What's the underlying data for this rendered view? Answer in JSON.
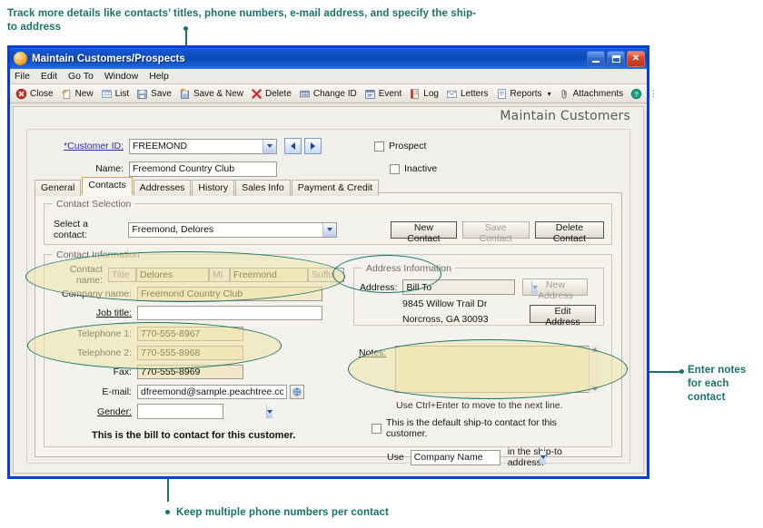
{
  "annotations": {
    "top": "Track more details like contacts’ titles, phone numbers, e-mail address, and specify the ship-to address",
    "right": "Enter notes for each contact",
    "bottom": "Keep multiple phone numbers per contact",
    "accent_color": "#18736b",
    "highlight_fill": "#eee4aa"
  },
  "window": {
    "title": "Maintain Customers/Prospects",
    "controls": {
      "minimize": "Minimize",
      "maximize": "Maximize",
      "close": "Close"
    }
  },
  "menubar": {
    "items": [
      "File",
      "Edit",
      "Go To",
      "Window",
      "Help"
    ]
  },
  "toolbar": {
    "items": [
      {
        "label": "Close",
        "icon": "close-circle-icon"
      },
      {
        "label": "New",
        "icon": "new-page-icon"
      },
      {
        "label": "List",
        "icon": "list-grid-icon"
      },
      {
        "label": "Save",
        "icon": "save-disk-icon"
      },
      {
        "label": "Save & New",
        "icon": "save-new-icon"
      },
      {
        "label": "Delete",
        "icon": "delete-x-icon"
      },
      {
        "label": "Change ID",
        "icon": "change-id-icon"
      },
      {
        "label": "Event",
        "icon": "event-icon"
      },
      {
        "label": "Log",
        "icon": "log-book-icon"
      },
      {
        "label": "Letters",
        "icon": "letters-envelope-icon"
      },
      {
        "label": "Reports",
        "icon": "reports-icon",
        "has_dropdown": true
      },
      {
        "label": "Attachments",
        "icon": "paperclip-icon"
      }
    ],
    "help_icon": "help-question-icon",
    "overflow_icon": "toolbar-overflow-icon"
  },
  "page": {
    "header": "Maintain Customers"
  },
  "identity": {
    "customer_id_label": "*Customer ID:",
    "customer_id_value": "FREEMOND",
    "name_label": "Name:",
    "name_value": "Freemond Country Club",
    "prev_label": "Previous record",
    "next_label": "Next record",
    "prospect_label": "Prospect",
    "prospect_checked": false,
    "inactive_label": "Inactive",
    "inactive_checked": false
  },
  "tabs": [
    {
      "label": "General",
      "active": false
    },
    {
      "label": "Contacts",
      "active": true
    },
    {
      "label": "Addresses",
      "active": false
    },
    {
      "label": "History",
      "active": false
    },
    {
      "label": "Sales Info",
      "active": false
    },
    {
      "label": "Payment & Credit",
      "active": false
    }
  ],
  "contact_selection": {
    "title": "Contact Selection",
    "select_label": "Select a contact:",
    "select_value": "Freemond, Delores",
    "new_contact": "New Contact",
    "save_contact": "Save Contact",
    "delete_contact": "Delete Contact"
  },
  "contact_information": {
    "title": "Contact Information",
    "contact_name_label": "Contact name:",
    "title_placeholder": "Title",
    "title_value": "",
    "first_name_value": "Delores",
    "mi_placeholder": "MI",
    "mi_value": "",
    "last_name_value": "Freemond",
    "suffix_placeholder": "Suffix",
    "suffix_value": "",
    "company_name_label": "Company name:",
    "company_name_value": "Freemond Country Club",
    "job_title_label": "Job title:",
    "job_title_value": "",
    "telephone1_label": "Telephone 1:",
    "telephone1_value": "770-555-8967",
    "telephone2_label": "Telephone 2:",
    "telephone2_value": "770-555-8968",
    "fax_label": "Fax:",
    "fax_value": "770-555-8969",
    "email_label": "E-mail:",
    "email_value": "dfreemond@sample.peachtree.com",
    "email_button_icon": "email-globe-icon",
    "gender_label": "Gender:",
    "gender_value": "",
    "bill_to_note": "This is the bill to contact for this customer."
  },
  "address_information": {
    "title": "Address Information",
    "address_label": "Address:",
    "address_value": "Bill To",
    "new_address": "New Address",
    "edit_address": "Edit Address",
    "street": "9845 Willow Trail Dr",
    "city_state_zip": "Norcross, GA 30093"
  },
  "notes": {
    "label": "Notes:",
    "value": "",
    "hint": "Use Ctrl+Enter to move to the next line.",
    "scroll_up_icon": "scroll-up-icon",
    "scroll_down_icon": "scroll-down-icon"
  },
  "ship_to": {
    "default_checkbox_label": "This is the default ship-to contact for this customer.",
    "default_checked": false,
    "use_label": "Use",
    "use_value": "Company Name",
    "suffix_label": "in the ship-to address."
  }
}
